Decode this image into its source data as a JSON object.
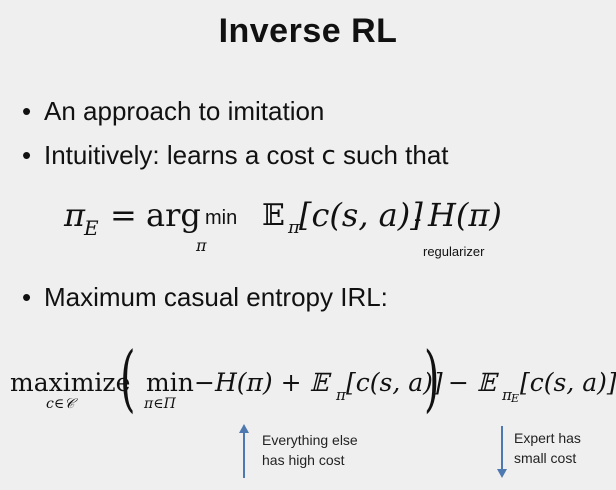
{
  "slide": {
    "title": "Inverse RL",
    "bullet1": "An approach to imitation",
    "bullet2_prefix": "Intuitively: learns a cost ",
    "bullet2_var": "c",
    "bullet2_suffix": " such that",
    "bullet3": "Maximum casual entropy IRL:"
  },
  "eq1": {
    "lhs": "π",
    "lhs_sub": "E",
    "equals": "=",
    "argmin_arg": "arg",
    "argmin_min": "min",
    "argmin_sub": "π",
    "expectation": "𝔼",
    "exp_sub": "π",
    "expr": "[c(s, a)]",
    "minus": "-",
    "entropy": "H(π)",
    "regularizer_label": "regularizer"
  },
  "eq2": {
    "maximize": "maximize",
    "maximize_sub": "c∈𝒞",
    "min": "min",
    "min_sub": "π∈Π",
    "inner": "−H(π) + 𝔼",
    "inner_sub": "π",
    "inner_expr": "[c(s, a)]",
    "outer": "− 𝔼",
    "outer_sub": "π",
    "outer_subsub": "E",
    "outer_expr": "[c(s, a)]"
  },
  "annotations": {
    "left_line1": "Everything else",
    "left_line2": "has high cost",
    "right_line1": "Expert has",
    "right_line2": "small cost"
  }
}
